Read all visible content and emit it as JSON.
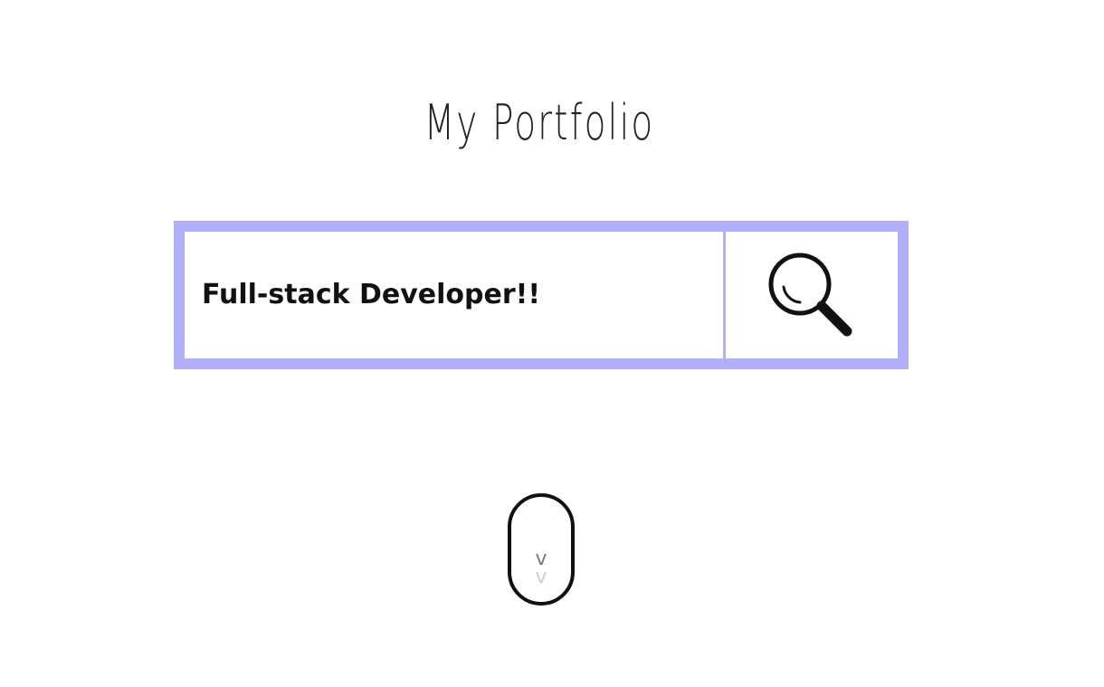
{
  "header": {
    "title": "My Portfolio"
  },
  "search": {
    "value": "Full-stack Developer!!",
    "border_color": "#b3b0fb",
    "button_icon": "magnifying-glass-icon"
  },
  "scroll_indicator": {
    "icon": "scroll-down-mouse-icon",
    "chevron_glyph": "v"
  }
}
